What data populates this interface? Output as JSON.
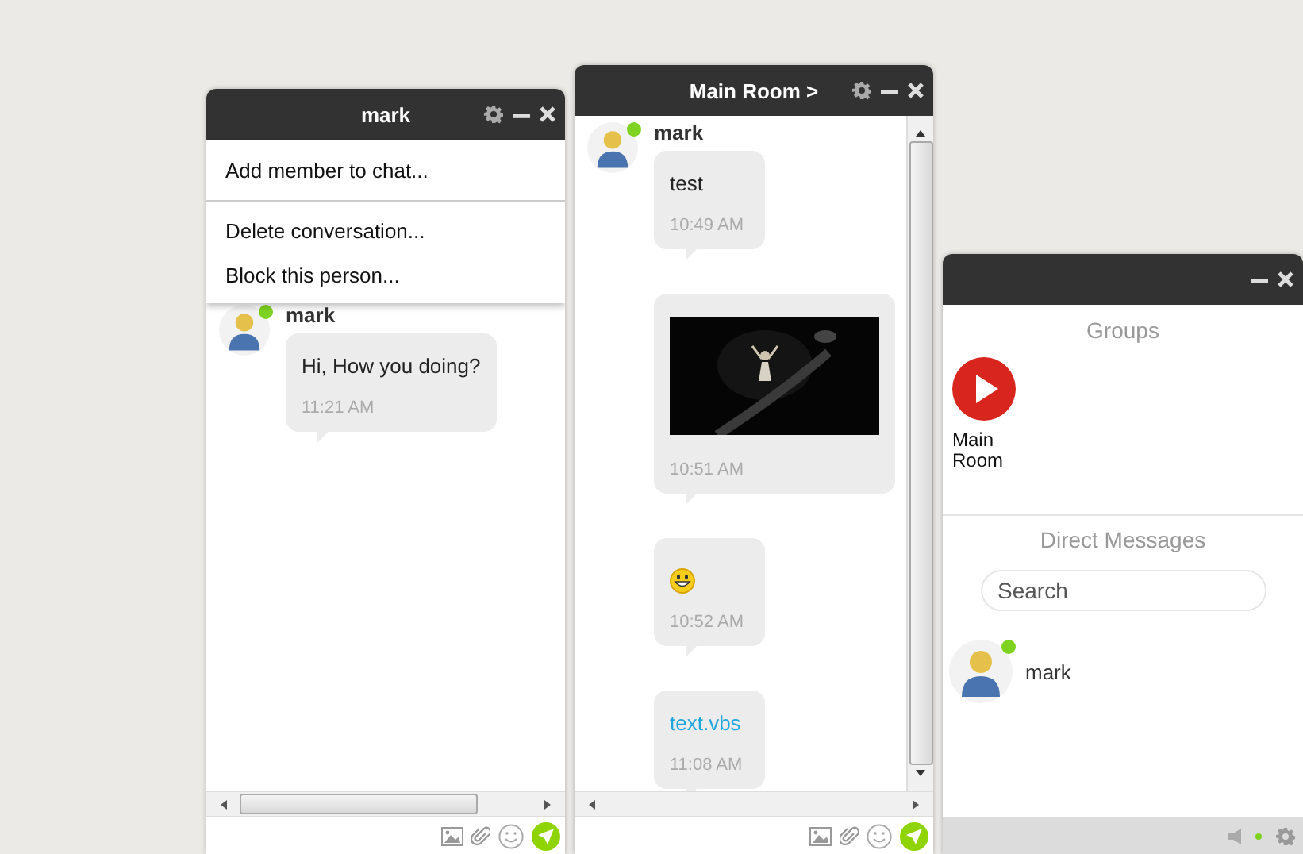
{
  "chat_windows": [
    {
      "title": "mark",
      "menu": {
        "groups": [
          [
            "Add member to chat..."
          ],
          [
            "Delete conversation...",
            "Block this person..."
          ]
        ]
      },
      "messages": [
        {
          "sender": "mark",
          "online": true,
          "kind": "text",
          "text": "Hi, How you doing?",
          "time": "11:21 AM"
        }
      ]
    },
    {
      "title": "Main Room >",
      "messages": [
        {
          "sender": "mark",
          "online": true,
          "kind": "text",
          "text": "test",
          "time": "10:49 AM"
        },
        {
          "kind": "picture",
          "time": "10:51 AM"
        },
        {
          "kind": "emoji",
          "time": "10:52 AM"
        },
        {
          "kind": "file",
          "text": "text.vbs",
          "time": "11:08 AM"
        }
      ]
    }
  ],
  "contacts_panel": {
    "groups_title": "Groups",
    "groups": [
      {
        "name": "Main Room"
      }
    ],
    "direct_title": "Direct Messages",
    "search": {
      "placeholder": "Search"
    },
    "contacts": [
      {
        "name": "mark",
        "online": true
      }
    ],
    "footer": {
      "online": true
    }
  }
}
